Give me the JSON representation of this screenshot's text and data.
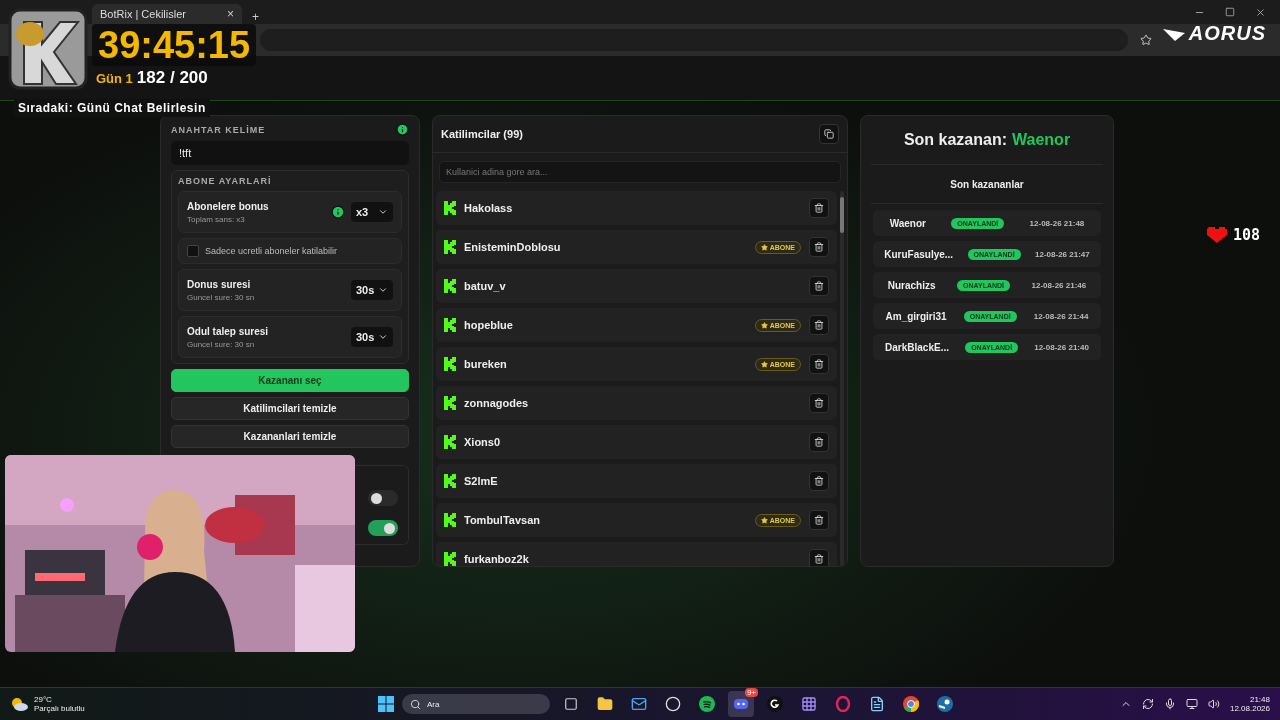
{
  "browser": {
    "tab_title": "BotRix | Cekilisler",
    "close_tab": "×",
    "new_tab": "+"
  },
  "overlay": {
    "timer": "39:45:15",
    "day": "Gün 1",
    "progress": "182 / 200",
    "next": "Sıradaki: Günü Chat Belirlesin",
    "brand": "AORUS",
    "hearts": "108"
  },
  "settings": {
    "keyword_label": "ANAHTAR KELİME",
    "keyword": "!tft",
    "sub_title": "ABONE AYARLARİ",
    "rows": [
      {
        "kind": "select",
        "title": "Abonelere bonus",
        "hint": "Toplam sans: x3",
        "value": "x3",
        "info": true
      },
      {
        "kind": "checkbox",
        "title": "Sadece ucretli aboneler katilabilir",
        "checked": false
      },
      {
        "kind": "select",
        "title": "Donus suresi",
        "hint": "Guncel sure: 30 sn",
        "value": "30s",
        "info": false
      },
      {
        "kind": "select",
        "title": "Odul talep suresi",
        "hint": "Guncel sure: 30 sn",
        "value": "30s",
        "info": false
      }
    ],
    "buttons": [
      {
        "label": "Kazananı seç",
        "primary": true
      },
      {
        "label": "Katilimcilari temizle",
        "primary": false
      },
      {
        "label": "Kazananlari temizle",
        "primary": false
      }
    ],
    "toggles": [
      {
        "on": false
      },
      {
        "on": true
      }
    ]
  },
  "participants": {
    "title": "Katilimcilar (99)",
    "search_placeholder": "Kullanici adina gore ara...",
    "rows": [
      {
        "name": "Hakolass"
      },
      {
        "name": "EnisteminDoblosu",
        "badge": "ABONE"
      },
      {
        "name": "batuv_v"
      },
      {
        "name": "hopeblue",
        "badge": "ABONE"
      },
      {
        "name": "bureken",
        "badge": "ABONE"
      },
      {
        "name": "zonnagodes"
      },
      {
        "name": "Xions0"
      },
      {
        "name": "S2lmE"
      },
      {
        "name": "TombulTavsan",
        "badge": "ABONE"
      },
      {
        "name": "furkanboz2k"
      }
    ]
  },
  "winners": {
    "title": "Son kazanan:",
    "name": "Waenor",
    "list_title": "Son kazananlar",
    "rows": [
      {
        "name": "Waenor",
        "status": "ONAYLANDİ",
        "time": "12-08-26 21:48"
      },
      {
        "name": "KuruFasulye...",
        "status": "ONAYLANDİ",
        "time": "12-08-26 21:47"
      },
      {
        "name": "Nurachizs",
        "status": "ONAYLANDİ",
        "time": "12-08-26 21:46"
      },
      {
        "name": "Am_girgiri31",
        "status": "ONAYLANDİ",
        "time": "12-08-26 21:44"
      },
      {
        "name": "DarkBlackE...",
        "status": "ONAYLANDİ",
        "time": "12-08-26 21:40"
      }
    ]
  },
  "taskbar": {
    "temp": "29°C",
    "weather": "Parçalı bulutlu",
    "search": "Ara",
    "time": "21:48",
    "date": "12.08.2026",
    "apps": [
      {
        "kind": "taskview",
        "selected": false
      },
      {
        "kind": "folder",
        "selected": false
      },
      {
        "kind": "mail",
        "selected": false
      },
      {
        "kind": "obs",
        "selected": false
      },
      {
        "kind": "spotify",
        "selected": false
      },
      {
        "kind": "discord",
        "badge": "9+",
        "selected": true
      },
      {
        "kind": "logi",
        "selected": false
      },
      {
        "kind": "grid",
        "selected": false
      },
      {
        "kind": "opera",
        "selected": false
      },
      {
        "kind": "notes",
        "selected": false
      },
      {
        "kind": "chrome",
        "selected": false
      },
      {
        "kind": "steam",
        "selected": false
      }
    ]
  }
}
